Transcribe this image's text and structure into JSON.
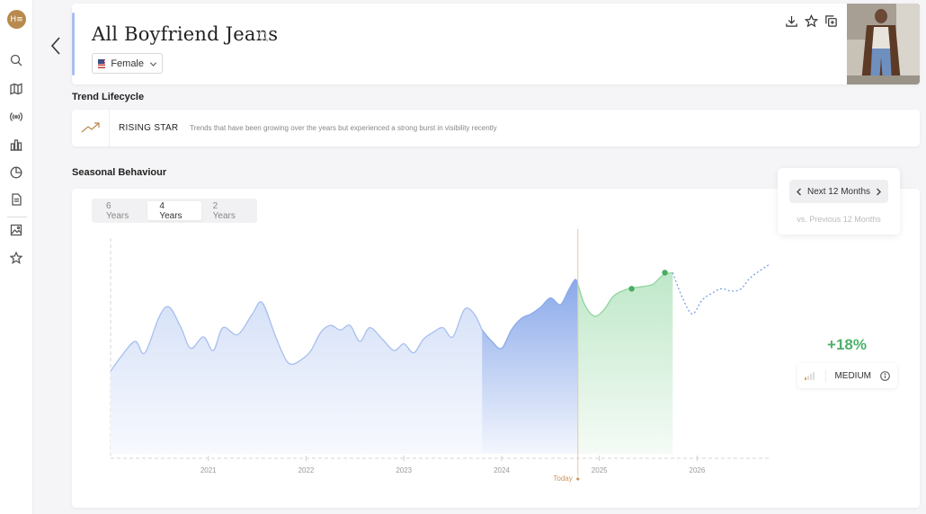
{
  "app": {
    "logo_text": "H≡"
  },
  "nav": {
    "items": [
      {
        "name": "search"
      },
      {
        "name": "map"
      },
      {
        "name": "broadcast"
      },
      {
        "name": "city"
      },
      {
        "name": "pie-chart"
      },
      {
        "name": "document"
      },
      {
        "name": "image"
      },
      {
        "name": "star"
      }
    ]
  },
  "header": {
    "title": "All Boyfriend Jeans",
    "gender_label": "Female"
  },
  "lifecycle": {
    "section_title": "Trend Lifecycle",
    "label": "RISING STAR",
    "description": "Trends that have been growing over the years but experienced a strong burst in visibility recently"
  },
  "seasonal": {
    "section_title": "Seasonal Behaviour",
    "tabs": [
      {
        "label": "6 Years",
        "active": false
      },
      {
        "label": "4 Years",
        "active": true
      },
      {
        "label": "2 Years",
        "active": false
      }
    ],
    "forecast": {
      "period_label": "Next 12 Months",
      "compare_label": "vs. Previous 12 Months",
      "growth": "+18%",
      "level": "MEDIUM"
    }
  },
  "chart_data": {
    "type": "area",
    "x_ticks": [
      "2021",
      "2022",
      "2023",
      "2024",
      "2025",
      "2026"
    ],
    "today_label": "Today",
    "colors": {
      "history": "#a7bfee",
      "recent": "#8aa9ea",
      "forecast": "#8fd69f",
      "future_line": "#7aa0e6",
      "today_line": "#e7c9a3",
      "today_dot": "#c9955a",
      "marker": "#49ad62"
    },
    "series": [
      {
        "values": [
          [
            2020.0,
            38
          ],
          [
            2020.1,
            44
          ],
          [
            2020.25,
            51
          ],
          [
            2020.35,
            46
          ],
          [
            2020.5,
            62
          ],
          [
            2020.6,
            66
          ],
          [
            2020.72,
            57
          ],
          [
            2020.82,
            48
          ],
          [
            2020.95,
            53
          ],
          [
            2021.05,
            47
          ],
          [
            2021.15,
            57
          ],
          [
            2021.3,
            54
          ],
          [
            2021.45,
            63
          ],
          [
            2021.55,
            68
          ],
          [
            2021.68,
            54
          ],
          [
            2021.78,
            44
          ],
          [
            2021.85,
            41
          ],
          [
            2021.95,
            43
          ],
          [
            2022.05,
            47
          ],
          [
            2022.15,
            55
          ],
          [
            2022.25,
            58
          ],
          [
            2022.35,
            56
          ],
          [
            2022.45,
            58
          ],
          [
            2022.55,
            51
          ],
          [
            2022.65,
            57
          ],
          [
            2022.78,
            52
          ],
          [
            2022.9,
            47
          ],
          [
            2023.0,
            50
          ],
          [
            2023.1,
            46
          ],
          [
            2023.2,
            52
          ],
          [
            2023.3,
            55
          ],
          [
            2023.4,
            57
          ],
          [
            2023.5,
            53
          ],
          [
            2023.62,
            65
          ],
          [
            2023.72,
            63
          ],
          [
            2023.8,
            56
          ]
        ]
      },
      {
        "values": [
          [
            2023.8,
            56
          ],
          [
            2023.9,
            51
          ],
          [
            2024.0,
            48
          ],
          [
            2024.1,
            56
          ],
          [
            2024.2,
            61
          ],
          [
            2024.3,
            63
          ],
          [
            2024.4,
            66
          ],
          [
            2024.5,
            70
          ],
          [
            2024.6,
            67
          ],
          [
            2024.68,
            73
          ],
          [
            2024.75,
            78
          ],
          [
            2024.78,
            76
          ]
        ]
      },
      {
        "values": [
          [
            2024.78,
            76
          ],
          [
            2024.85,
            67
          ],
          [
            2024.95,
            62
          ],
          [
            2025.05,
            65
          ],
          [
            2025.15,
            71
          ],
          [
            2025.3,
            74
          ],
          [
            2025.45,
            75
          ],
          [
            2025.55,
            76
          ],
          [
            2025.65,
            80
          ],
          [
            2025.75,
            81
          ]
        ],
        "markers": [
          [
            2025.33,
            74
          ],
          [
            2025.67,
            81
          ]
        ]
      },
      {
        "values": [
          [
            2025.75,
            81
          ],
          [
            2025.85,
            70
          ],
          [
            2025.95,
            63
          ],
          [
            2026.05,
            69
          ],
          [
            2026.15,
            72
          ],
          [
            2026.25,
            74
          ],
          [
            2026.35,
            73
          ],
          [
            2026.45,
            74
          ],
          [
            2026.55,
            79
          ],
          [
            2026.75,
            85
          ]
        ]
      }
    ],
    "today_x": 2024.78,
    "xlim": [
      2020.0,
      2026.75
    ],
    "ylim": [
      0,
      100
    ],
    "grid": false
  }
}
